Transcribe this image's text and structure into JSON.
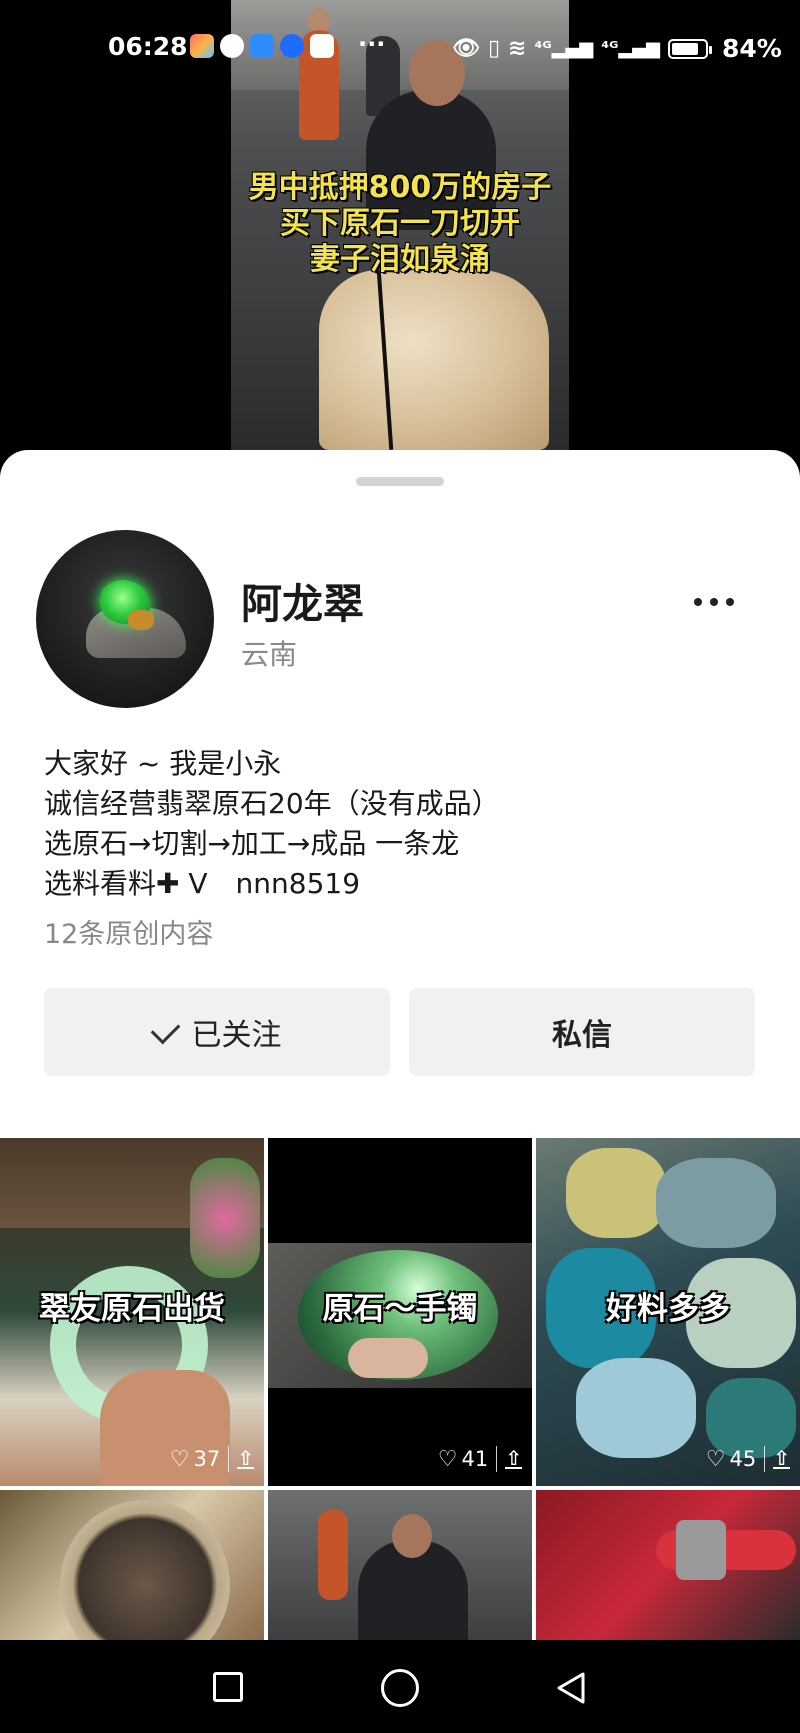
{
  "status_bar": {
    "time": "06:28",
    "more": "···",
    "battery": "84%",
    "battery_level": 0.84
  },
  "video": {
    "caption_lines": [
      "男中抵押800万的房子",
      "买下原石一刀切开",
      "妻子泪如泉涌"
    ]
  },
  "profile": {
    "name": "阿龙翠",
    "location": "云南",
    "bio_lines": [
      "大家好 ~ 我是小永",
      "诚信经营翡翠原石20年（没有成品）",
      "选原石→切割→加工→成品 一条龙",
      "选料看料✚ V　nnn8519"
    ],
    "posts_count": "12条原创内容",
    "follow_label": "已关注",
    "message_label": "私信"
  },
  "grid": {
    "thumbs": [
      {
        "title": "翠友原石出货",
        "likes": "37"
      },
      {
        "title": "原石～手镯",
        "likes": "41"
      },
      {
        "title": "好料多多",
        "likes": "45"
      }
    ]
  },
  "icons": {
    "heart": "heart-icon",
    "share": "share-icon",
    "check": "check-icon"
  }
}
